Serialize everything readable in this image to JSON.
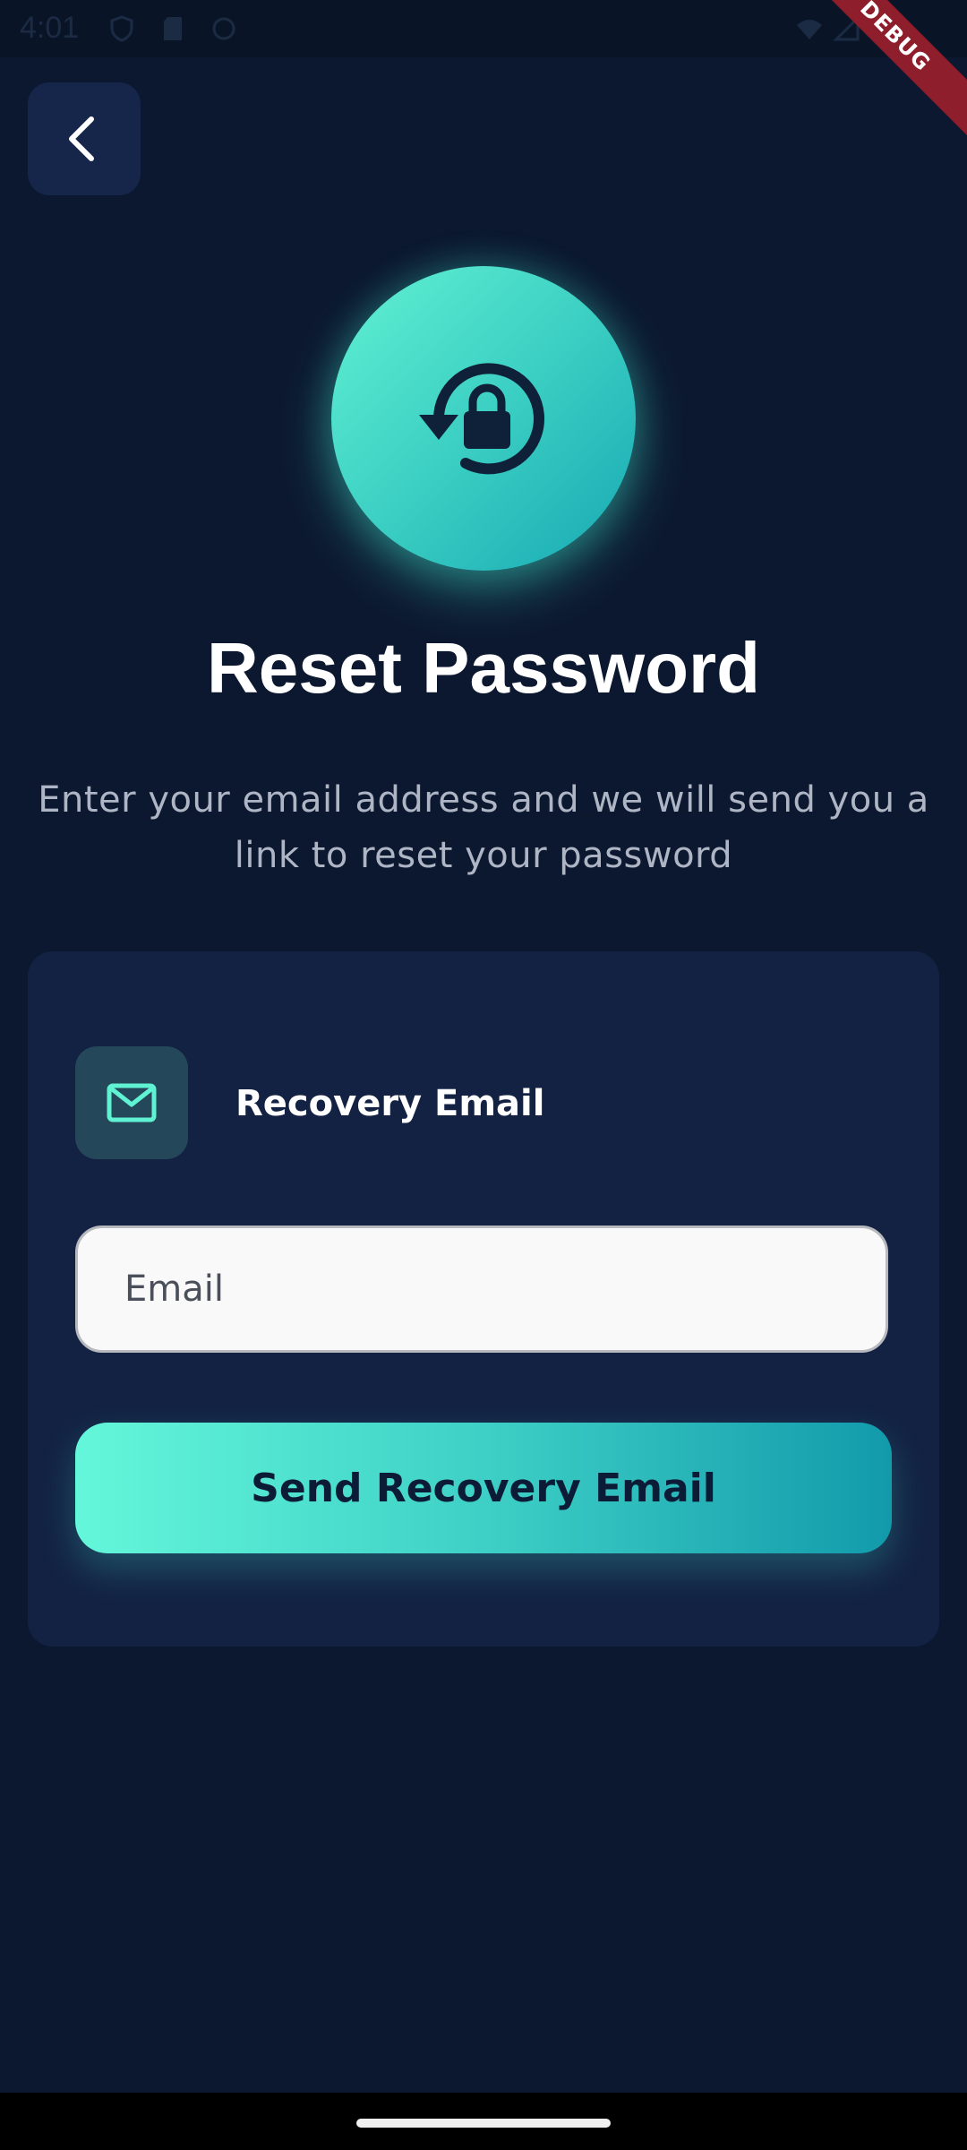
{
  "status_bar": {
    "time": "4:01",
    "debug_label": "DEBUG"
  },
  "header": {
    "back_icon": "chevron-left-icon"
  },
  "hero": {
    "icon": "lock-reset-icon",
    "title": "Reset Password",
    "subtitle": "Enter your email address and we will send you a link to reset your password"
  },
  "form": {
    "section_icon": "mail-icon",
    "section_label": "Recovery Email",
    "email_placeholder": "Email",
    "email_value": "",
    "submit_label": "Send Recovery Email"
  },
  "colors": {
    "background": "#0c1830",
    "card": "#132243",
    "accent_start": "#64f7da",
    "accent_end": "#129aab",
    "text_primary": "#ffffff",
    "text_secondary": "#aeb5c4"
  }
}
